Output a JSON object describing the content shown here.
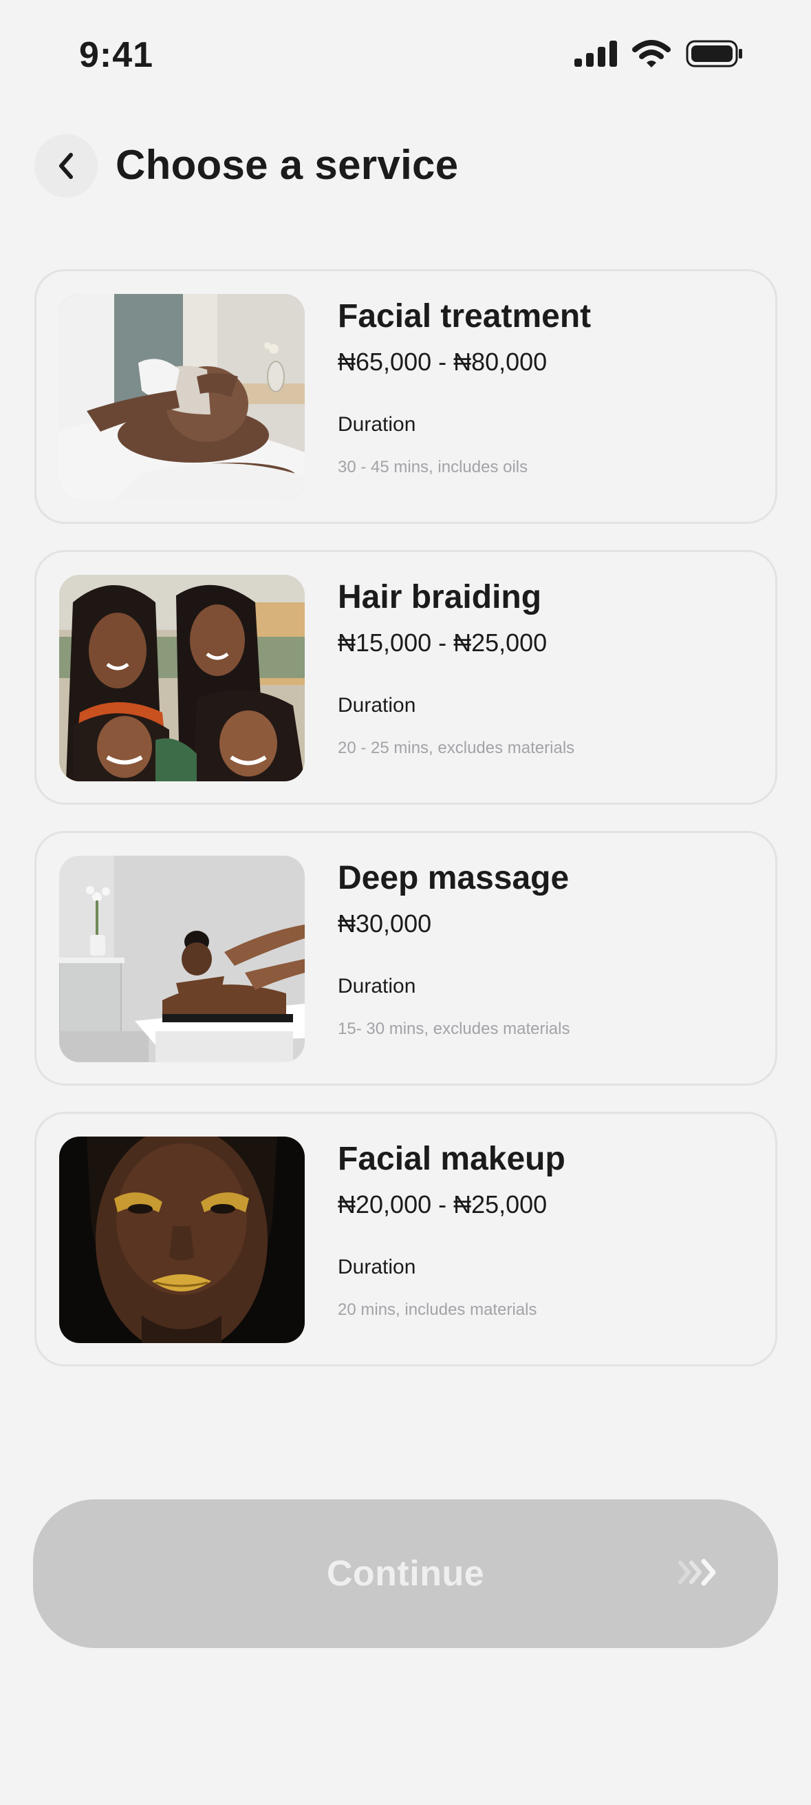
{
  "status_bar": {
    "time": "9:41"
  },
  "header": {
    "title": "Choose a service",
    "back_icon": "chevron-left-icon"
  },
  "services": [
    {
      "name": "Facial treatment",
      "price": "₦65,000 - ₦80,000",
      "duration_label": "Duration",
      "duration": "30 - 45 mins, includes oils",
      "image": "facial-treatment-photo"
    },
    {
      "name": "Hair braiding",
      "price": "₦15,000 - ₦25,000",
      "duration_label": "Duration",
      "duration": "20 - 25 mins, excludes materials",
      "image": "hair-braiding-photo"
    },
    {
      "name": "Deep massage",
      "price": "₦30,000",
      "duration_label": "Duration",
      "duration": "15- 30 mins, excludes materials",
      "image": "deep-massage-photo"
    },
    {
      "name": "Facial makeup",
      "price": "₦20,000 - ₦25,000",
      "duration_label": "Duration",
      "duration": "20 mins, includes materials",
      "image": "facial-makeup-photo"
    }
  ],
  "continue_button": {
    "label": "Continue",
    "state": "disabled",
    "icon": "chevron-double-right-icon"
  },
  "colors": {
    "background": "#f3f3f3",
    "card_border": "#e2e2e2",
    "button_disabled": "#c8c8c8",
    "muted_text": "#a2a2a8"
  }
}
